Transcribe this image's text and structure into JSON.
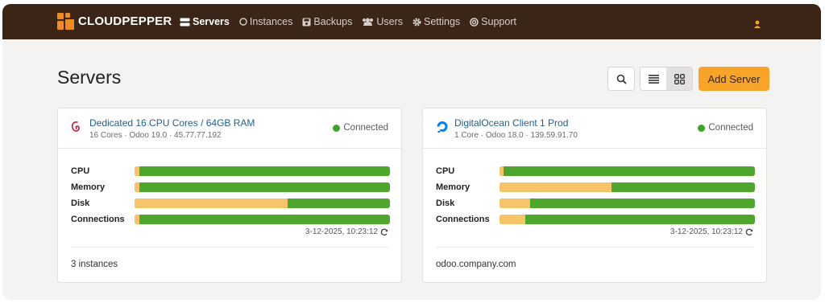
{
  "app": {
    "brand": "CLOUDPEPPER"
  },
  "nav": {
    "items": [
      {
        "label": "Servers",
        "icon": "server-icon",
        "active": true
      },
      {
        "label": "Instances",
        "icon": "circle-icon",
        "active": false
      },
      {
        "label": "Backups",
        "icon": "backup-icon",
        "active": false
      },
      {
        "label": "Users",
        "icon": "users-icon",
        "active": false
      },
      {
        "label": "Settings",
        "icon": "gear-icon",
        "active": false
      },
      {
        "label": "Support",
        "icon": "support-icon",
        "active": false
      }
    ]
  },
  "page": {
    "title": "Servers"
  },
  "toolbar": {
    "add_label": "Add Server",
    "view_mode": "grid"
  },
  "colors": {
    "accent": "#f7a428",
    "topbar": "#3b2517",
    "used": "#f7c46a",
    "free": "#4ea62c",
    "link": "#1f5f8c",
    "connected": "#3ea32a"
  },
  "servers": [
    {
      "name": "Dedicated 16 CPU Cores / 64GB RAM",
      "meta": "16 Cores · Odoo 19.0 · 45.77.77.192",
      "os_icon": "debian-icon",
      "status": "Connected",
      "metrics": [
        {
          "label": "CPU",
          "used": 0.02
        },
        {
          "label": "Memory",
          "used": 0.02
        },
        {
          "label": "Disk",
          "used": 0.6
        },
        {
          "label": "Connections",
          "used": 0.02
        }
      ],
      "updated": "3-12-2025, 10:23:12",
      "footer": "3 instances"
    },
    {
      "name": "DigitalOcean Client 1 Prod",
      "meta": "1 Core · Odoo 18.0 · 139.59.91.70",
      "os_icon": "digitalocean-icon",
      "status": "Connected",
      "metrics": [
        {
          "label": "CPU",
          "used": 0.015
        },
        {
          "label": "Memory",
          "used": 0.44
        },
        {
          "label": "Disk",
          "used": 0.12
        },
        {
          "label": "Connections",
          "used": 0.1
        }
      ],
      "updated": "3-12-2025, 10:23:12",
      "footer": "odoo.company.com"
    }
  ]
}
